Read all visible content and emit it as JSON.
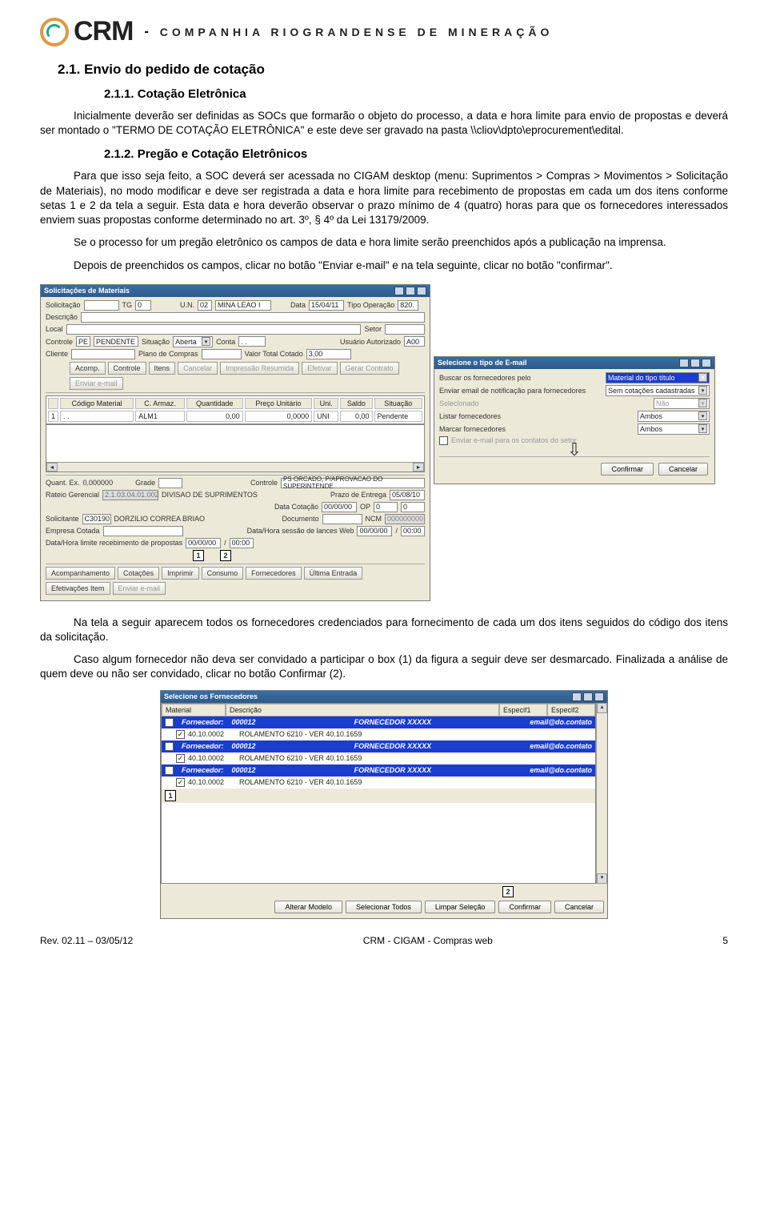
{
  "header": {
    "logo_text": "CRM",
    "separator": "-",
    "company": "COMPANHIA  RIOGRANDENSE  DE  MINERAÇÃO"
  },
  "section21": {
    "num_title": "2.1. Envio do pedido de cotação",
    "sub211": "2.1.1. Cotação Eletrônica",
    "p1": "Inicialmente deverão ser definidas as SOCs que formarão o objeto do processo, a data e hora limite para envio de propostas e deverá ser montado o \"TERMO DE COTAÇÃO ELETRÔNICA\" e este deve ser gravado na pasta \\\\cliov\\dpto\\eprocurement\\edital.",
    "sub212": "2.1.2. Pregão e Cotação Eletrônicos",
    "p2": "Para que isso seja feito, a SOC deverá ser acessada no CIGAM desktop (menu: Suprimentos > Compras > Movimentos > Solicitação de Materiais), no modo modificar e deve ser registrada a data e hora limite para recebimento de propostas em cada um dos itens conforme setas 1 e 2 da tela a seguir. Esta data e hora deverão observar o prazo mínimo de 4 (quatro) horas para que os fornecedores interessados enviem suas propostas conforme determinado no art. 3º, § 4º da Lei 13179/2009.",
    "p3": "Se o processo for um pregão eletrônico os campos de data e hora limite serão preenchidos após a publicação na imprensa.",
    "p4": "Depois de preenchidos os campos, clicar no botão \"Enviar e-mail\" e na tela seguinte, clicar no botão \"confirmar\"."
  },
  "win1": {
    "title": "Solicitações de Materiais",
    "labels": {
      "solicitacao": "Solicitação",
      "tg": "TG",
      "tg_v": "0",
      "un": "U.N.",
      "un_code": "02",
      "un_name": "MINA LEAO I",
      "data": "Data",
      "data_v": "15/04/11",
      "tipo_op": "Tipo Operação",
      "tipo_op_v": "820.",
      "descricao": "Descrição",
      "local": "Local",
      "setor": "Setor",
      "controle": "Controle",
      "controle_code": "PE",
      "controle_name": "PENDENTE",
      "situacao": "Situação",
      "situacao_v": "Aberta",
      "conta": "Conta",
      "conta_v": ". .",
      "usuario": "Usuário Autorizado",
      "usuario_v": "A00",
      "cliente": "Cliente",
      "plano": "Plano de Compras",
      "vtotal": "Valor Total Cotado",
      "vtotal_v": "3,00"
    },
    "toolbar1": [
      "Acomp.",
      "Controle",
      "Itens",
      "Cancelar",
      "Impressão Resumida",
      "Efetivar",
      "Gerar Contrato",
      "Enviar e-mail"
    ],
    "grid_headers": [
      "Código Material",
      "C. Armaz.",
      "Quantidade",
      "Preço Unitário",
      "Uni.",
      "Saldo",
      "Situação"
    ],
    "grid_row": {
      "idx": "1",
      "cod": ". .",
      "arm": "ALM1",
      "q": "0,00",
      "pu": "0,0000",
      "uni": "UNI",
      "saldo": "0,00",
      "sit": "Pendente"
    },
    "lower": {
      "quant": "Quant. Ex.",
      "quant_v": "0,000000",
      "grade": "Grade",
      "controle2": "Controle",
      "controle2_v": "PS  ORCADO, P/APROVACAO DO SUPERINTENDE",
      "rateio": "Rateio Gerencial",
      "rateio_v": "2.1.03.04.01.002",
      "rateio_desc": "DIVISAO DE SUPRIMENTOS",
      "prazo": "Prazo de Entrega",
      "prazo_v": "05/08/10",
      "datacot": "Data Cotação",
      "datacot_v": "00/00/00",
      "op": "OP",
      "op_v": "0",
      "zero": "0",
      "solic": "Solicitante",
      "solic_code": "C30190",
      "solic_name": "DORZILIO CORREA BRIAO",
      "doc": "Documento",
      "ncm": "NCM",
      "ncm_v": "000000000",
      "emp": "Empresa Cotada",
      "sessao": "Data/Hora sessão de lances Web",
      "sessao_d": "00/00/00",
      "sessao_h": "00:00",
      "limite": "Data/Hora limite recebimento de propostas",
      "limite_d": "00/00/00",
      "limite_h": "00:00",
      "b1": "1",
      "b2": "2"
    },
    "toolbar2": [
      "Acompanhamento",
      "Cotações",
      "Imprimir",
      "Consumo",
      "Fornecedores",
      "Última Entrada",
      "Efetivações Item",
      "Enviar e-mail"
    ]
  },
  "win_email": {
    "title": "Selecione o tipo de E-mail",
    "rows": [
      {
        "lbl": "Buscar os fornecedores pelo",
        "val": "Material do tipo título",
        "highlight": true
      },
      {
        "lbl": "Enviar email de notificação para fornecedores",
        "val": "Sem cotações cadastradas"
      },
      {
        "lbl": "Selecionado",
        "val": "Não",
        "disabled": true
      },
      {
        "lbl": "Listar fornecedores",
        "val": "Ambos"
      },
      {
        "lbl": "Marcar fornecedores",
        "val": "Ambos"
      }
    ],
    "chk_lbl": "Enviar e-mail para os contatos do setor",
    "confirm": "Confirmar",
    "cancel": "Cancelar"
  },
  "after_screens": {
    "p1": "Na tela a seguir aparecem todos os fornecedores credenciados para fornecimento de cada um dos itens seguidos do código dos itens da solicitação.",
    "p2": "Caso algum fornecedor não deva ser convidado a participar o box (1) da figura a seguir deve ser desmarcado. Finalizada a análise de quem deve ou não ser convidado, clicar no botão Confirmar (2)."
  },
  "win_forn": {
    "title": "Selecione os Fornecedores",
    "headers": [
      "Material",
      "Descrição",
      "Especif1",
      "Especif2"
    ],
    "supplier": {
      "lbl": "Fornecedor:",
      "code": "000012",
      "name": "FORNECEDOR XXXXX",
      "email": "email@do.contato"
    },
    "item": {
      "code": "40.10.0002",
      "desc": "ROLAMENTO 6210 - VER 40.10.1659"
    },
    "b1": "1",
    "b2": "2",
    "buttons": [
      "Alterar Modelo",
      "Selecionar Todos",
      "Limpar Seleção",
      "Confirmar",
      "Cancelar"
    ]
  },
  "footer": {
    "left": "Rev. 02.11 – 03/05/12",
    "center": "CRM - CIGAM - Compras web",
    "right": "5"
  }
}
